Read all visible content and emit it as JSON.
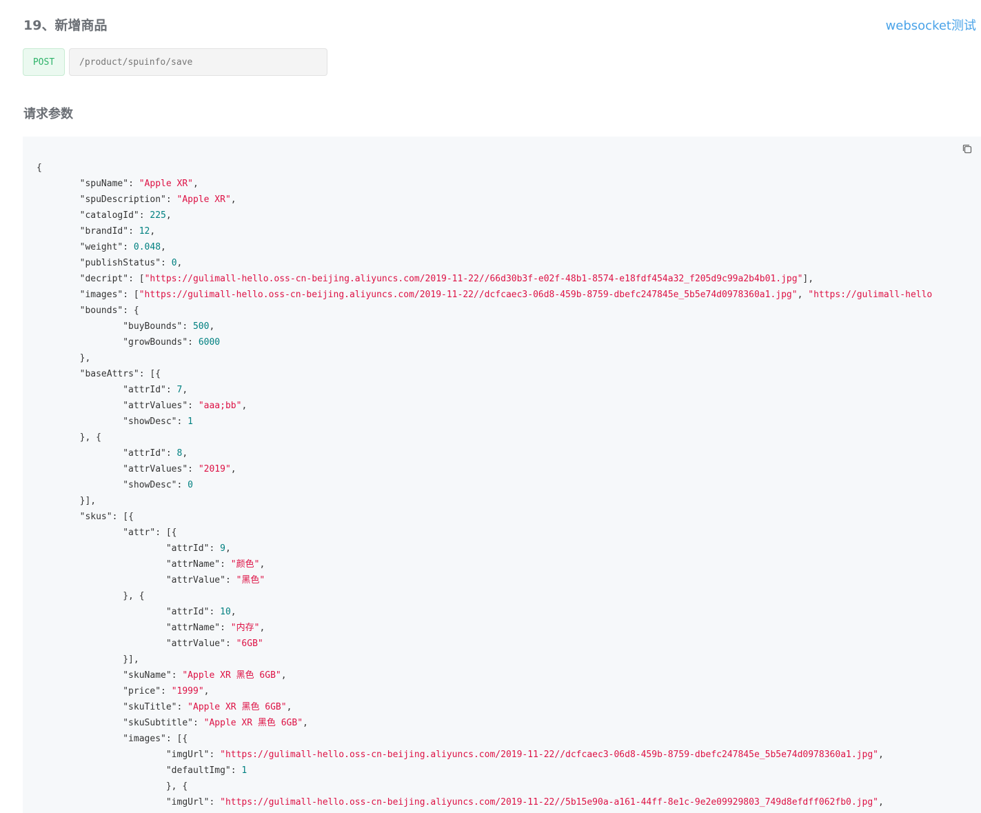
{
  "header": {
    "title": "19、新增商品",
    "ws_link": "websocket测试"
  },
  "endpoint": {
    "method": "POST",
    "url": "/product/spuinfo/save"
  },
  "section": {
    "request_params": "请求参数"
  },
  "code_lines": [
    [
      [
        "p",
        "{"
      ]
    ],
    [
      [
        "p",
        "\t"
      ],
      [
        "k",
        "\"spuName\""
      ],
      [
        "p",
        ": "
      ],
      [
        "s",
        "\"Apple XR\""
      ],
      [
        "p",
        ","
      ]
    ],
    [
      [
        "p",
        "\t"
      ],
      [
        "k",
        "\"spuDescription\""
      ],
      [
        "p",
        ": "
      ],
      [
        "s",
        "\"Apple XR\""
      ],
      [
        "p",
        ","
      ]
    ],
    [
      [
        "p",
        "\t"
      ],
      [
        "k",
        "\"catalogId\""
      ],
      [
        "p",
        ": "
      ],
      [
        "n",
        "225"
      ],
      [
        "p",
        ","
      ]
    ],
    [
      [
        "p",
        "\t"
      ],
      [
        "k",
        "\"brandId\""
      ],
      [
        "p",
        ": "
      ],
      [
        "n",
        "12"
      ],
      [
        "p",
        ","
      ]
    ],
    [
      [
        "p",
        "\t"
      ],
      [
        "k",
        "\"weight\""
      ],
      [
        "p",
        ": "
      ],
      [
        "n",
        "0.048"
      ],
      [
        "p",
        ","
      ]
    ],
    [
      [
        "p",
        "\t"
      ],
      [
        "k",
        "\"publishStatus\""
      ],
      [
        "p",
        ": "
      ],
      [
        "n",
        "0"
      ],
      [
        "p",
        ","
      ]
    ],
    [
      [
        "p",
        "\t"
      ],
      [
        "k",
        "\"decript\""
      ],
      [
        "p",
        ": ["
      ],
      [
        "s",
        "\"https://gulimall-hello.oss-cn-beijing.aliyuncs.com/2019-11-22//66d30b3f-e02f-48b1-8574-e18fdf454a32_f205d9c99a2b4b01.jpg\""
      ],
      [
        "p",
        "],"
      ]
    ],
    [
      [
        "p",
        "\t"
      ],
      [
        "k",
        "\"images\""
      ],
      [
        "p",
        ": ["
      ],
      [
        "s",
        "\"https://gulimall-hello.oss-cn-beijing.aliyuncs.com/2019-11-22//dcfcaec3-06d8-459b-8759-dbefc247845e_5b5e74d0978360a1.jpg\""
      ],
      [
        "p",
        ", "
      ],
      [
        "s",
        "\"https://gulimall-hello"
      ]
    ],
    [
      [
        "p",
        "\t"
      ],
      [
        "k",
        "\"bounds\""
      ],
      [
        "p",
        ": {"
      ]
    ],
    [
      [
        "p",
        "\t\t"
      ],
      [
        "k",
        "\"buyBounds\""
      ],
      [
        "p",
        ": "
      ],
      [
        "n",
        "500"
      ],
      [
        "p",
        ","
      ]
    ],
    [
      [
        "p",
        "\t\t"
      ],
      [
        "k",
        "\"growBounds\""
      ],
      [
        "p",
        ": "
      ],
      [
        "n",
        "6000"
      ]
    ],
    [
      [
        "p",
        "\t},"
      ]
    ],
    [
      [
        "p",
        "\t"
      ],
      [
        "k",
        "\"baseAttrs\""
      ],
      [
        "p",
        ": [{"
      ]
    ],
    [
      [
        "p",
        "\t\t"
      ],
      [
        "k",
        "\"attrId\""
      ],
      [
        "p",
        ": "
      ],
      [
        "n",
        "7"
      ],
      [
        "p",
        ","
      ]
    ],
    [
      [
        "p",
        "\t\t"
      ],
      [
        "k",
        "\"attrValues\""
      ],
      [
        "p",
        ": "
      ],
      [
        "s",
        "\"aaa;bb\""
      ],
      [
        "p",
        ","
      ]
    ],
    [
      [
        "p",
        "\t\t"
      ],
      [
        "k",
        "\"showDesc\""
      ],
      [
        "p",
        ": "
      ],
      [
        "n",
        "1"
      ]
    ],
    [
      [
        "p",
        "\t}, {"
      ]
    ],
    [
      [
        "p",
        "\t\t"
      ],
      [
        "k",
        "\"attrId\""
      ],
      [
        "p",
        ": "
      ],
      [
        "n",
        "8"
      ],
      [
        "p",
        ","
      ]
    ],
    [
      [
        "p",
        "\t\t"
      ],
      [
        "k",
        "\"attrValues\""
      ],
      [
        "p",
        ": "
      ],
      [
        "s",
        "\"2019\""
      ],
      [
        "p",
        ","
      ]
    ],
    [
      [
        "p",
        "\t\t"
      ],
      [
        "k",
        "\"showDesc\""
      ],
      [
        "p",
        ": "
      ],
      [
        "n",
        "0"
      ]
    ],
    [
      [
        "p",
        "\t}],"
      ]
    ],
    [
      [
        "p",
        "\t"
      ],
      [
        "k",
        "\"skus\""
      ],
      [
        "p",
        ": [{"
      ]
    ],
    [
      [
        "p",
        "\t\t"
      ],
      [
        "k",
        "\"attr\""
      ],
      [
        "p",
        ": [{"
      ]
    ],
    [
      [
        "p",
        "\t\t\t"
      ],
      [
        "k",
        "\"attrId\""
      ],
      [
        "p",
        ": "
      ],
      [
        "n",
        "9"
      ],
      [
        "p",
        ","
      ]
    ],
    [
      [
        "p",
        "\t\t\t"
      ],
      [
        "k",
        "\"attrName\""
      ],
      [
        "p",
        ": "
      ],
      [
        "s",
        "\"颜色\""
      ],
      [
        "p",
        ","
      ]
    ],
    [
      [
        "p",
        "\t\t\t"
      ],
      [
        "k",
        "\"attrValue\""
      ],
      [
        "p",
        ": "
      ],
      [
        "s",
        "\"黑色\""
      ]
    ],
    [
      [
        "p",
        "\t\t}, {"
      ]
    ],
    [
      [
        "p",
        "\t\t\t"
      ],
      [
        "k",
        "\"attrId\""
      ],
      [
        "p",
        ": "
      ],
      [
        "n",
        "10"
      ],
      [
        "p",
        ","
      ]
    ],
    [
      [
        "p",
        "\t\t\t"
      ],
      [
        "k",
        "\"attrName\""
      ],
      [
        "p",
        ": "
      ],
      [
        "s",
        "\"内存\""
      ],
      [
        "p",
        ","
      ]
    ],
    [
      [
        "p",
        "\t\t\t"
      ],
      [
        "k",
        "\"attrValue\""
      ],
      [
        "p",
        ": "
      ],
      [
        "s",
        "\"6GB\""
      ]
    ],
    [
      [
        "p",
        "\t\t}],"
      ]
    ],
    [
      [
        "p",
        "\t\t"
      ],
      [
        "k",
        "\"skuName\""
      ],
      [
        "p",
        ": "
      ],
      [
        "s",
        "\"Apple XR 黑色 6GB\""
      ],
      [
        "p",
        ","
      ]
    ],
    [
      [
        "p",
        "\t\t"
      ],
      [
        "k",
        "\"price\""
      ],
      [
        "p",
        ": "
      ],
      [
        "s",
        "\"1999\""
      ],
      [
        "p",
        ","
      ]
    ],
    [
      [
        "p",
        "\t\t"
      ],
      [
        "k",
        "\"skuTitle\""
      ],
      [
        "p",
        ": "
      ],
      [
        "s",
        "\"Apple XR 黑色 6GB\""
      ],
      [
        "p",
        ","
      ]
    ],
    [
      [
        "p",
        "\t\t"
      ],
      [
        "k",
        "\"skuSubtitle\""
      ],
      [
        "p",
        ": "
      ],
      [
        "s",
        "\"Apple XR 黑色 6GB\""
      ],
      [
        "p",
        ","
      ]
    ],
    [
      [
        "p",
        "\t\t"
      ],
      [
        "k",
        "\"images\""
      ],
      [
        "p",
        ": [{"
      ]
    ],
    [
      [
        "p",
        "\t\t\t"
      ],
      [
        "k",
        "\"imgUrl\""
      ],
      [
        "p",
        ": "
      ],
      [
        "s",
        "\"https://gulimall-hello.oss-cn-beijing.aliyuncs.com/2019-11-22//dcfcaec3-06d8-459b-8759-dbefc247845e_5b5e74d0978360a1.jpg\""
      ],
      [
        "p",
        ","
      ]
    ],
    [
      [
        "p",
        "\t\t\t"
      ],
      [
        "k",
        "\"defaultImg\""
      ],
      [
        "p",
        ": "
      ],
      [
        "n",
        "1"
      ]
    ],
    [
      [
        "p",
        "\t\t\t}, {"
      ]
    ],
    [
      [
        "p",
        "\t\t\t"
      ],
      [
        "k",
        "\"imgUrl\""
      ],
      [
        "p",
        ": "
      ],
      [
        "s",
        "\"https://gulimall-hello.oss-cn-beijing.aliyuncs.com/2019-11-22//5b15e90a-a161-44ff-8e1c-9e2e09929803_749d8efdff062fb0.jpg\""
      ],
      [
        "p",
        ","
      ]
    ]
  ],
  "colors": {
    "key": "#333333",
    "string": "#dd1144",
    "number": "#008080",
    "link": "#4aa3e8",
    "method": "#2fb36a"
  },
  "icons": {
    "copy": "copy-icon"
  }
}
